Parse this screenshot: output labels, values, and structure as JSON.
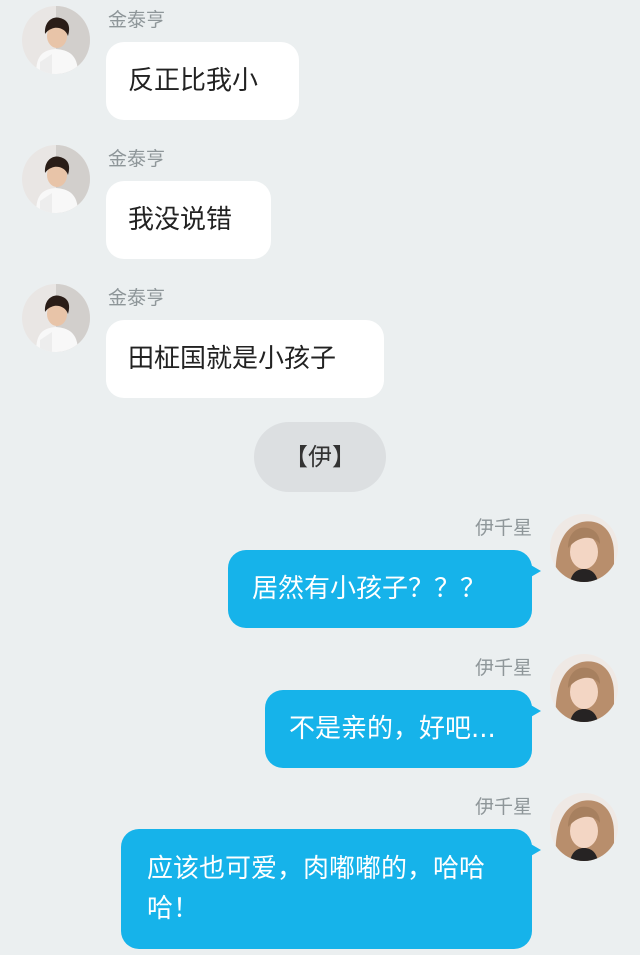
{
  "messages": [
    {
      "direction": "incoming",
      "sender": "金泰亨",
      "text": "反正比我小"
    },
    {
      "direction": "incoming",
      "sender": "金泰亨",
      "text": "我没说错"
    },
    {
      "direction": "incoming",
      "sender": "金泰亨",
      "text": "田柾国就是小孩子"
    },
    {
      "direction": "outgoing",
      "sender": "伊千星",
      "text": "居然有小孩子？？？"
    },
    {
      "direction": "outgoing",
      "sender": "伊千星",
      "text": "不是亲的，好吧..."
    },
    {
      "direction": "outgoing",
      "sender": "伊千星",
      "text": "应该也可爱，肉嘟嘟的，哈哈哈！"
    }
  ],
  "system_tag": "【伊】",
  "colors": {
    "background": "#ebeff0",
    "incoming_bubble": "#ffffff",
    "outgoing_bubble": "#16b3ea",
    "sender_name": "#8e9699",
    "system_pill": "#dcdfe1"
  },
  "icons": {
    "incoming_avatar": "avatar-man-photo",
    "outgoing_avatar": "avatar-woman-photo"
  }
}
